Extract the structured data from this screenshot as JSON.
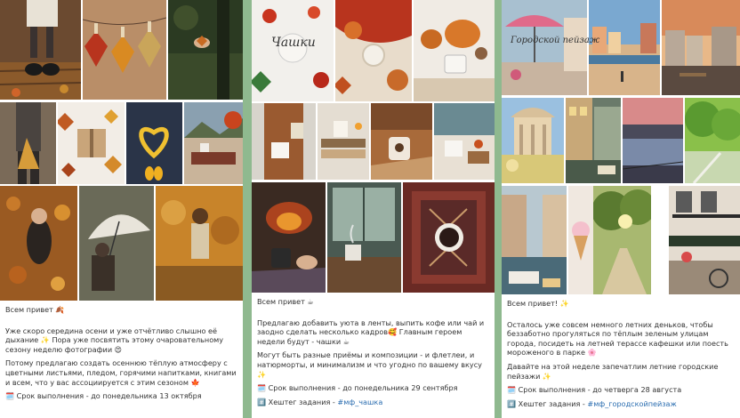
{
  "posts": [
    {
      "greeting": "Всем привет 🍂",
      "intro": "Уже скоро середина осени и уже отчётливо слышно её дыхание ✨ Пора уже посвятить этому очаровательному сезону неделю фотографии 😍",
      "body": "Потому предлагаю создать осеннюю тёплую атмосферу с цветными листьями, пледом, горячими напитками, книгами и всем, что у вас ассоциируется с этим сезоном 🍁",
      "deadline": "🗓️ Срок выполнения - до понедельника 13 октября"
    },
    {
      "overlay_title": "Чашки",
      "greeting": "Всем привет ☕",
      "intro": "Предлагаю добавить уюта в ленты, выпить кофе или чай и заодно сделать несколько кадров🥰 Главным героем недели будут - чашки ☕",
      "body": "Могут быть разные приёмы и композиции - и флетлеи, и натюрморты, и минимализм и что угодно по вашему вкусу ✨",
      "deadline": "🗓️ Срок выполнения - до понедельника 29 сентября",
      "hashtag_label": "#️⃣ Хештег задания - ",
      "hashtag": "#мф_чашка"
    },
    {
      "overlay_title": "Городской пейзаж",
      "greeting": "Всем привет! ✨",
      "intro": "Осталось уже совсем немного летних деньков, чтобы беззаботно прогуляться по тёплым зеленым улицам города, посидеть на летней терассе кафешки или поесть мороженого в парке 🌸",
      "body": "Давайте на этой неделе запечатлим летние городские пейзажи ✨",
      "deadline": "🗓️ Срок выполнения - до четверга 28 августа",
      "hashtag_label": "#️⃣ Хештег задания - ",
      "hashtag": "#мф_городскойпейзаж"
    }
  ],
  "colors": {
    "background": "#8fb98f",
    "hashtag": "#2a6db0",
    "caption_text": "#333333"
  }
}
